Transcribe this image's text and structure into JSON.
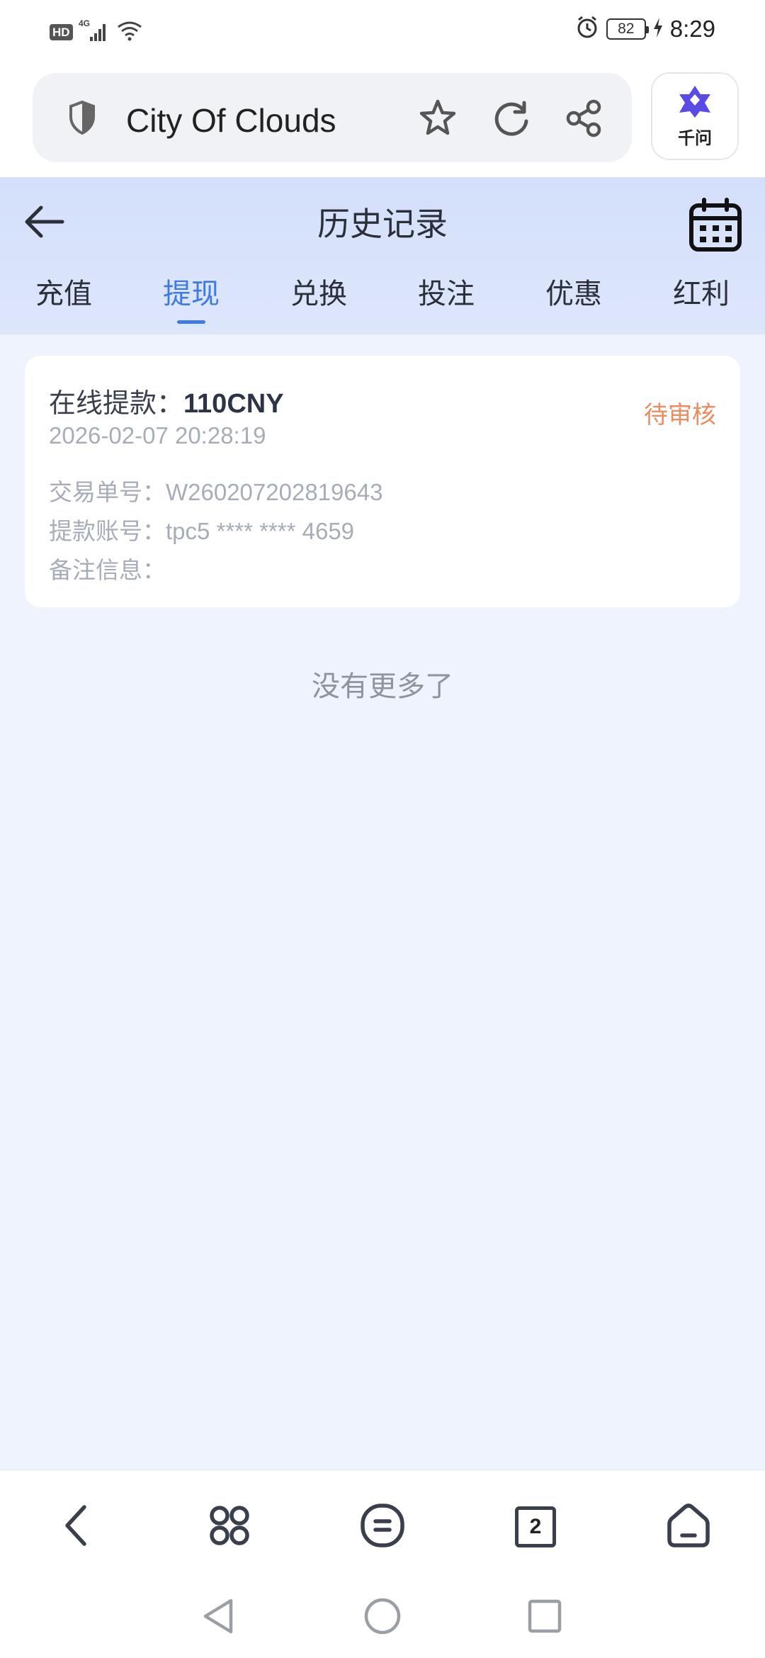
{
  "status_bar": {
    "hd_badge": "HD",
    "network_type": "4G",
    "battery_level": "82",
    "time": "8:29",
    "icons": [
      "signal-icon",
      "wifi-icon",
      "alarm-icon",
      "battery-icon",
      "charging-icon"
    ]
  },
  "browser": {
    "site_title": "City Of Clouds",
    "ai_button_label": "千问",
    "icons": [
      "shield-icon",
      "star-icon",
      "reload-icon",
      "share-icon",
      "ai-assistant-icon"
    ]
  },
  "header": {
    "title": "历史记录",
    "icons": [
      "back-arrow-icon",
      "calendar-icon"
    ]
  },
  "tabs": [
    {
      "label": "充值",
      "active": false
    },
    {
      "label": "提现",
      "active": true
    },
    {
      "label": "兑换",
      "active": false
    },
    {
      "label": "投注",
      "active": false
    },
    {
      "label": "优惠",
      "active": false
    },
    {
      "label": "红利",
      "active": false
    }
  ],
  "records": [
    {
      "title_label": "在线提款：",
      "amount": "110CNY",
      "status": "待审核",
      "datetime": "2026-02-07 20:28:19",
      "order_label": "交易单号：",
      "order_no": "W260207202819643",
      "account_label": "提款账号：",
      "account": "tpc5 **** **** 4659",
      "note_label": "备注信息：",
      "note": ""
    }
  ],
  "list_footer": "没有更多了",
  "bottom_toolbar": {
    "tab_count": "2",
    "icons": [
      "back-icon",
      "apps-icon",
      "menu-icon",
      "tabs-icon",
      "home-icon"
    ]
  },
  "android_nav": {
    "icons": [
      "nav-back-icon",
      "nav-home-icon",
      "nav-recents-icon"
    ]
  },
  "colors": {
    "accent": "#3f7ae0",
    "status_pending": "#ee8b5f",
    "header_bg": "#d4dffb",
    "page_bg": "#eef3fd"
  }
}
